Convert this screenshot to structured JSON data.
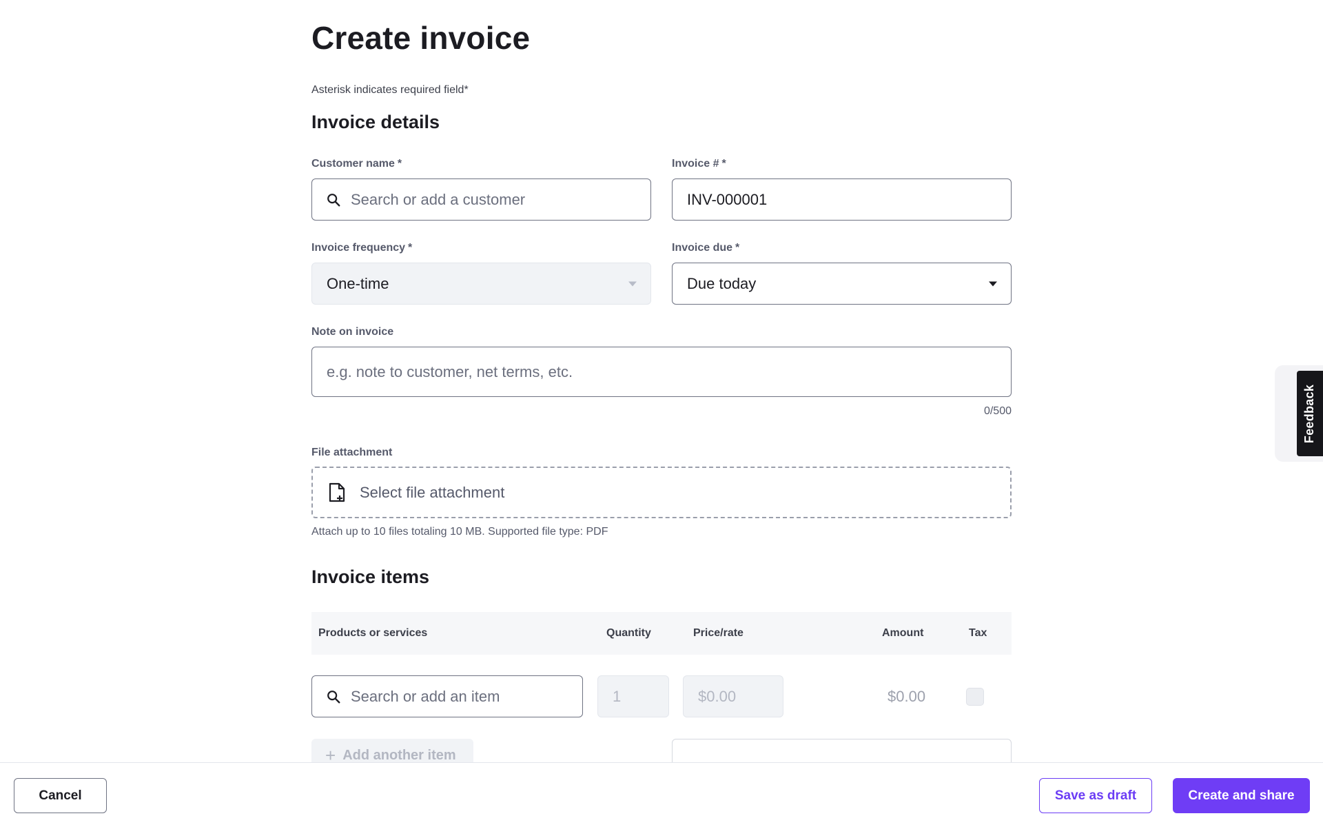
{
  "page": {
    "title": "Create invoice",
    "required_note": "Asterisk indicates required field*"
  },
  "invoice_details": {
    "section_title": "Invoice details",
    "customer_name": {
      "label": "Customer name",
      "required": "*",
      "placeholder": "Search or add a customer"
    },
    "invoice_number": {
      "label": "Invoice #",
      "required": "*",
      "value": "INV-000001"
    },
    "invoice_frequency": {
      "label": "Invoice frequency",
      "required": "*",
      "value": "One-time"
    },
    "invoice_due": {
      "label": "Invoice due",
      "required": "*",
      "value": "Due today"
    },
    "note": {
      "label": "Note on invoice",
      "placeholder": "e.g. note to customer, net terms, etc.",
      "counter": "0/500"
    },
    "file_attachment": {
      "label": "File attachment",
      "button_label": "Select file attachment",
      "helper": "Attach up to 10 files totaling 10 MB. Supported file type: PDF"
    }
  },
  "invoice_items": {
    "section_title": "Invoice items",
    "columns": [
      "Products or services",
      "Quantity",
      "Price/rate",
      "Amount",
      "Tax"
    ],
    "row": {
      "item_placeholder": "Search or add an item",
      "quantity": "1",
      "price": "$0.00",
      "amount": "$0.00"
    },
    "add_item_label": "Add another item"
  },
  "footer": {
    "cancel_label": "Cancel",
    "draft_label": "Save as draft",
    "primary_label": "Create and share"
  },
  "feedback_tab": {
    "label": "Feedback"
  },
  "colors": {
    "accent": "#6f3df5",
    "text": "#1c1c22",
    "muted": "#55596a",
    "border": "#6e7282"
  },
  "icons": {
    "search": "search-icon",
    "file": "file-plus-icon",
    "caret": "caret-down-icon",
    "plus": "plus-icon"
  }
}
